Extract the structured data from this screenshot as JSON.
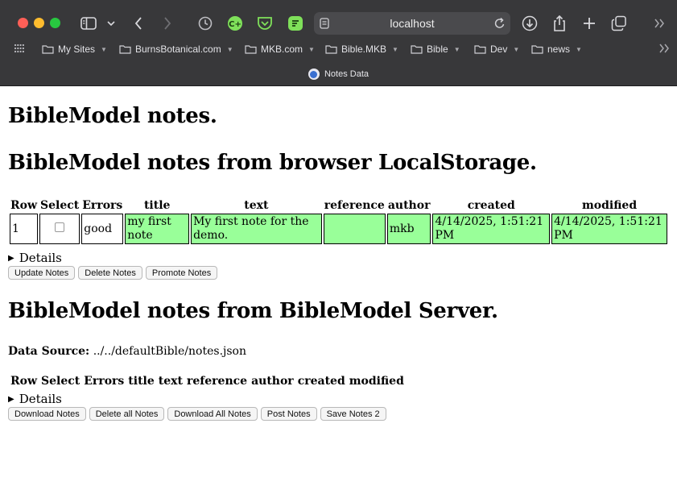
{
  "browser": {
    "url": "localhost",
    "tab_title": "Notes Data",
    "bookmarks": [
      {
        "label": "My Sites",
        "has_menu": true
      },
      {
        "label": "BurnsBotanical.com",
        "has_menu": true
      },
      {
        "label": "MKB.com",
        "has_menu": true
      },
      {
        "label": "Bible.MKB",
        "has_menu": true
      },
      {
        "label": "Bible",
        "has_menu": true
      },
      {
        "label": "Dev",
        "has_menu": true
      },
      {
        "label": "news",
        "has_menu": true
      }
    ]
  },
  "page": {
    "title": "BibleModel notes.",
    "local_section": {
      "heading": "BibleModel notes from browser LocalStorage.",
      "columns": [
        "Row",
        "Select",
        "Errors",
        "title",
        "text",
        "reference",
        "author",
        "created",
        "modified"
      ],
      "rows": [
        {
          "row": "1",
          "errors": "good",
          "title": "my first note",
          "text": "My first note for the demo.",
          "reference": "",
          "author": "mkb",
          "created": "4/14/2025, 1:51:21 PM",
          "modified": "4/14/2025, 1:51:21 PM"
        }
      ],
      "details_label": "Details",
      "buttons": [
        "Update Notes",
        "Delete Notes",
        "Promote Notes"
      ]
    },
    "server_section": {
      "heading": "BibleModel notes from BibleModel Server.",
      "data_source_label": "Data Source:",
      "data_source_value": "../../defaultBible/notes.json",
      "columns": [
        "Row",
        "Select",
        "Errors",
        "title",
        "text",
        "reference",
        "author",
        "created",
        "modified"
      ],
      "details_label": "Details",
      "buttons": [
        "Download Notes",
        "Delete all Notes",
        "Download All Notes",
        "Post Notes",
        "Save Notes 2"
      ]
    }
  },
  "colors": {
    "chrome_bg": "#38383a",
    "cell_green": "#99ff99"
  }
}
